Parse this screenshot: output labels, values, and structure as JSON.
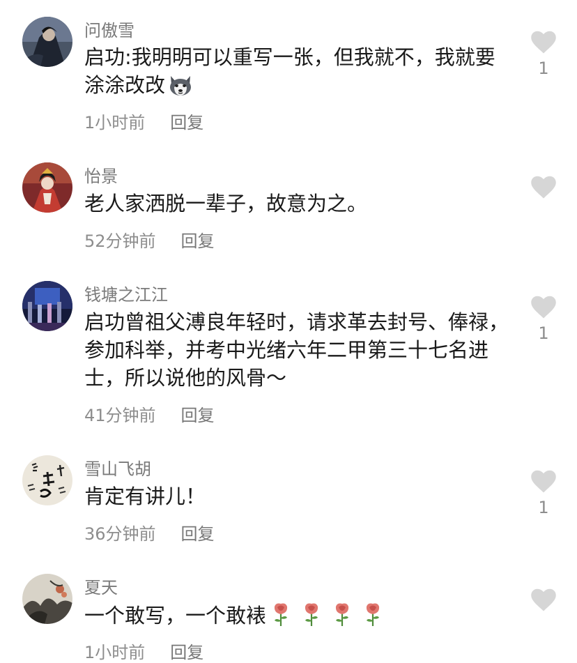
{
  "comments": [
    {
      "username": "问傲雪",
      "text": "启功:我明明可以重写一张，但我就不，我就要涂涂改改",
      "time": "1小时前",
      "reply_label": "回复",
      "likes": "1",
      "trailing_emoji": "husky-emoji",
      "avatar": "dark-figure-avatar"
    },
    {
      "username": "怡景",
      "text": "老人家洒脱一辈子，故意为之。",
      "time": "52分钟前",
      "reply_label": "回复",
      "likes": "",
      "avatar": "red-costume-avatar"
    },
    {
      "username": "钱塘之江江",
      "text": "启功曾祖父溥良年轻时，请求革去封号、俸禄，参加科举，并考中光绪六年二甲第三十七名进士，所以说他的风骨～",
      "time": "41分钟前",
      "reply_label": "回复",
      "likes": "1",
      "avatar": "stage-avatar"
    },
    {
      "username": "雪山飞胡",
      "text": "肯定有讲儿！",
      "time": "36分钟前",
      "reply_label": "回复",
      "likes": "1",
      "avatar": "calligraphy-avatar"
    },
    {
      "username": "夏天",
      "text": "一个敢写，一个敢裱",
      "time": "1小时前",
      "reply_label": "回复",
      "likes": "",
      "trailing_emoji": "rose-emoji x4",
      "avatar": "ink-painting-avatar"
    }
  ],
  "colors": {
    "username": "#7a7a7a",
    "text": "#1a1a1a",
    "meta": "#8d8d8d",
    "like_heart": "#d6d6d6"
  }
}
